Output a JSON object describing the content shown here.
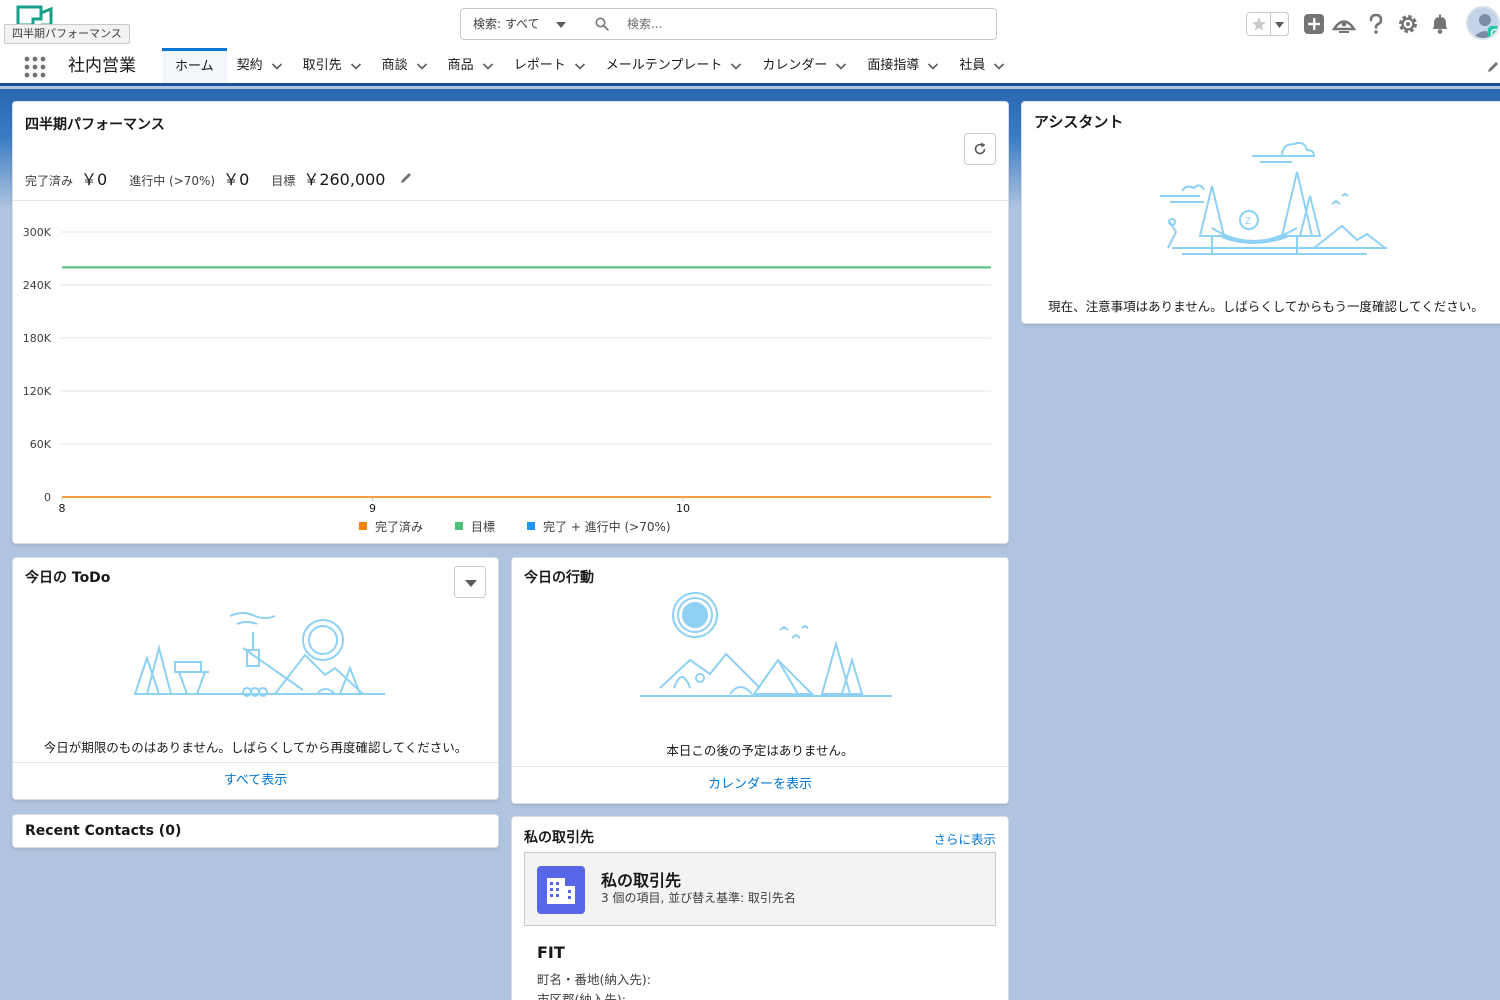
{
  "header": {
    "tooltip": "四半期パフォーマンス",
    "search_scope": "検索: すべて",
    "search_placeholder": "検索..."
  },
  "nav": {
    "app_name": "社内営業",
    "tabs": [
      {
        "label": "ホーム",
        "has_menu": false
      },
      {
        "label": "契約",
        "has_menu": true
      },
      {
        "label": "取引先",
        "has_menu": true
      },
      {
        "label": "商談",
        "has_menu": true
      },
      {
        "label": "商品",
        "has_menu": true
      },
      {
        "label": "レポート",
        "has_menu": true
      },
      {
        "label": "メールテンプレート",
        "has_menu": true
      },
      {
        "label": "カレンダー",
        "has_menu": true
      },
      {
        "label": "面接指導",
        "has_menu": true
      },
      {
        "label": "社員",
        "has_menu": true
      }
    ]
  },
  "performance": {
    "title": "四半期パフォーマンス",
    "closed_label": "完了済み",
    "closed_value": "￥0",
    "open_label": "進行中 (>70%)",
    "open_value": "￥0",
    "goal_label": "目標",
    "goal_value": "￥260,000"
  },
  "chart_data": {
    "type": "line",
    "x_ticks": [
      "8",
      "9",
      "10"
    ],
    "y_ticks": [
      "0",
      "60K",
      "120K",
      "180K",
      "240K",
      "300K"
    ],
    "ylim": [
      0,
      300000
    ],
    "xlim": [
      8,
      11
    ],
    "grid": true,
    "legend_position": "bottom",
    "series": [
      {
        "name": "完了済み",
        "color": "#f38303",
        "x": [
          8,
          11
        ],
        "y": [
          0,
          0
        ]
      },
      {
        "name": "目標",
        "color": "#4bc076",
        "x": [
          8,
          11
        ],
        "y": [
          260000,
          260000
        ]
      },
      {
        "name": "完了 + 進行中 (>70%)",
        "color": "#1b96ff",
        "x": [],
        "y": []
      }
    ]
  },
  "assistant": {
    "title": "アシスタント",
    "message": "現在、注意事項はありません。しばらくしてからもう一度確認してください。"
  },
  "todo": {
    "title": "今日の ToDo",
    "message": "今日が期限のものはありません。しばらくしてから再度確認してください。",
    "footer": "すべて表示"
  },
  "events": {
    "title": "今日の行動",
    "message": "本日この後の予定はありません。",
    "footer": "カレンダーを表示"
  },
  "contacts": {
    "title": "Recent Contacts (0)"
  },
  "accounts": {
    "title": "私の取引先",
    "more_link": "さらに表示",
    "list_title": "私の取引先",
    "list_sub": "3 個の項目, 並び替え基準: 取引先名",
    "first_account": "FIT",
    "field1": "町名・番地(納入先):",
    "field2": "市区郡(納入先):"
  },
  "colors": {
    "accent": "#0176d3",
    "nav_border": "#1b5297",
    "page_bg": "#b0c4df",
    "illustration": "#8ed1f5"
  }
}
